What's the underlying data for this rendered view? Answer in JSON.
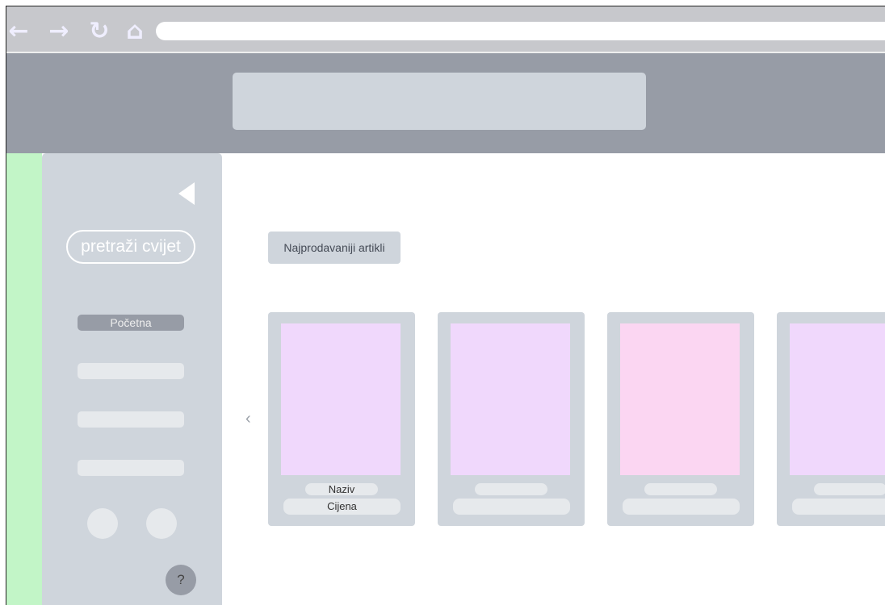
{
  "browser": {
    "nav_icons": [
      "back-arrow-icon",
      "forward-arrow-icon",
      "reload-icon",
      "home-icon"
    ],
    "url": ""
  },
  "sidebar": {
    "search_label": "pretraži cvijet",
    "items": [
      {
        "label": "Početna",
        "active": true
      },
      {
        "label": "",
        "active": false
      },
      {
        "label": "",
        "active": false
      },
      {
        "label": "",
        "active": false
      }
    ],
    "help_label": "?"
  },
  "main": {
    "section_title": "Najprodavaniji artikli",
    "products": [
      {
        "name": "Naziv",
        "price": "Cijena",
        "image_color": "#f0d8fc"
      },
      {
        "name": "",
        "price": "",
        "image_color": "#f0d8fc"
      },
      {
        "name": "",
        "price": "",
        "image_color": "#fbd6f2"
      },
      {
        "name": "",
        "price": "",
        "image_color": "#f0d8fc"
      }
    ]
  },
  "colors": {
    "chrome": "#c7c8cc",
    "header": "#979ca6",
    "panel": "#cfd5dc",
    "accent_green": "#c2f5c7"
  }
}
